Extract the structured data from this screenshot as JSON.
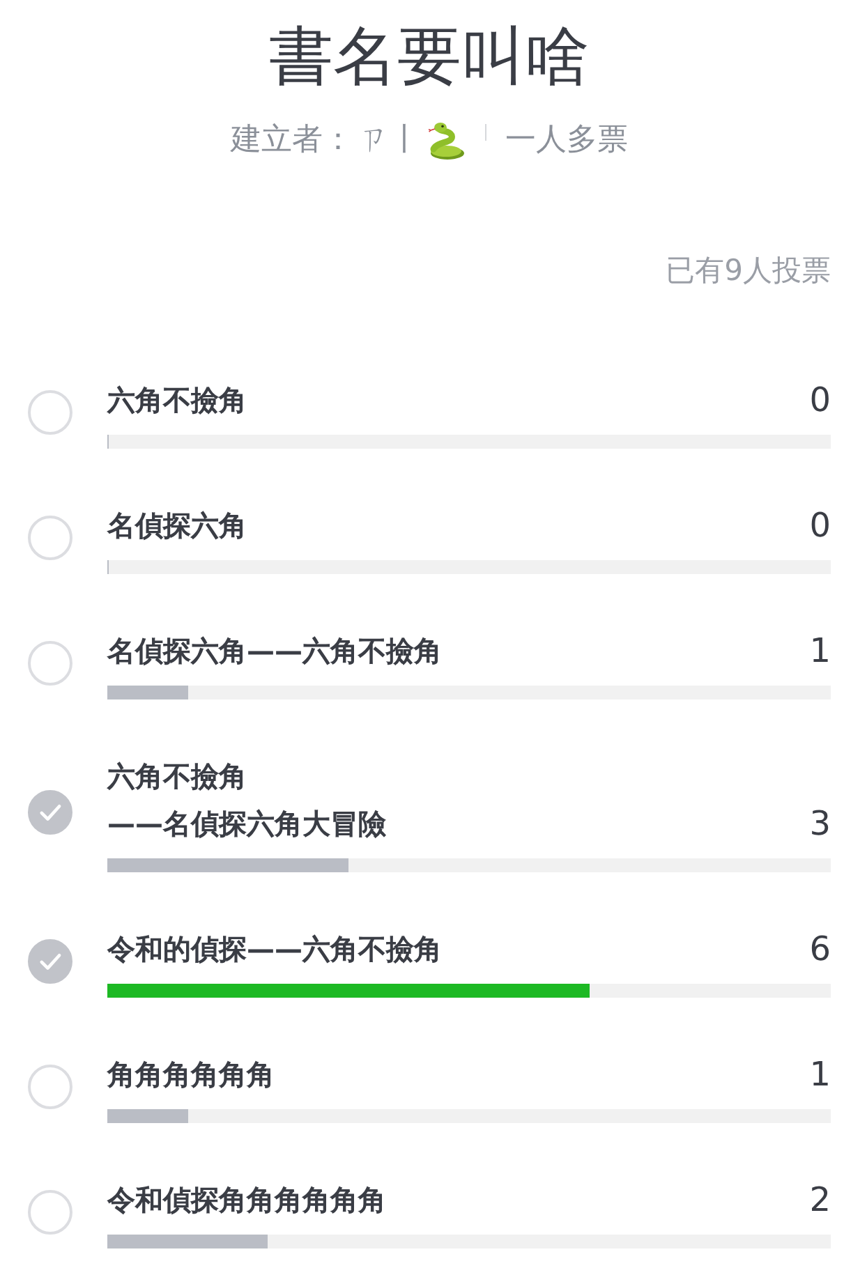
{
  "poll": {
    "title": "書名要叫啥",
    "creator_label": "建立者：",
    "creator_name": "ㄗ丨",
    "vote_mode": "一人多票",
    "voter_count": "已有9人投票"
  },
  "options": [
    {
      "label": "六角不撿角",
      "count": "0",
      "level": 0,
      "checked": false
    },
    {
      "label": "名偵探六角",
      "count": "0",
      "level": 0,
      "checked": false
    },
    {
      "label": "名偵探六角——六角不撿角",
      "count": "1",
      "level": 0.111,
      "checked": false
    },
    {
      "label": "六角不撿角\n——名偵探六角大冒險",
      "count": "3",
      "level": 0.333,
      "checked": true
    },
    {
      "label": "令和的偵探——六角不撿角",
      "count": "6",
      "level": 0.667,
      "checked": true
    },
    {
      "label": "角角角角角角",
      "count": "1",
      "level": 0.111,
      "checked": false
    },
    {
      "label": "令和偵探角角角角角角",
      "count": "2",
      "level": 0.222,
      "checked": false
    }
  ]
}
